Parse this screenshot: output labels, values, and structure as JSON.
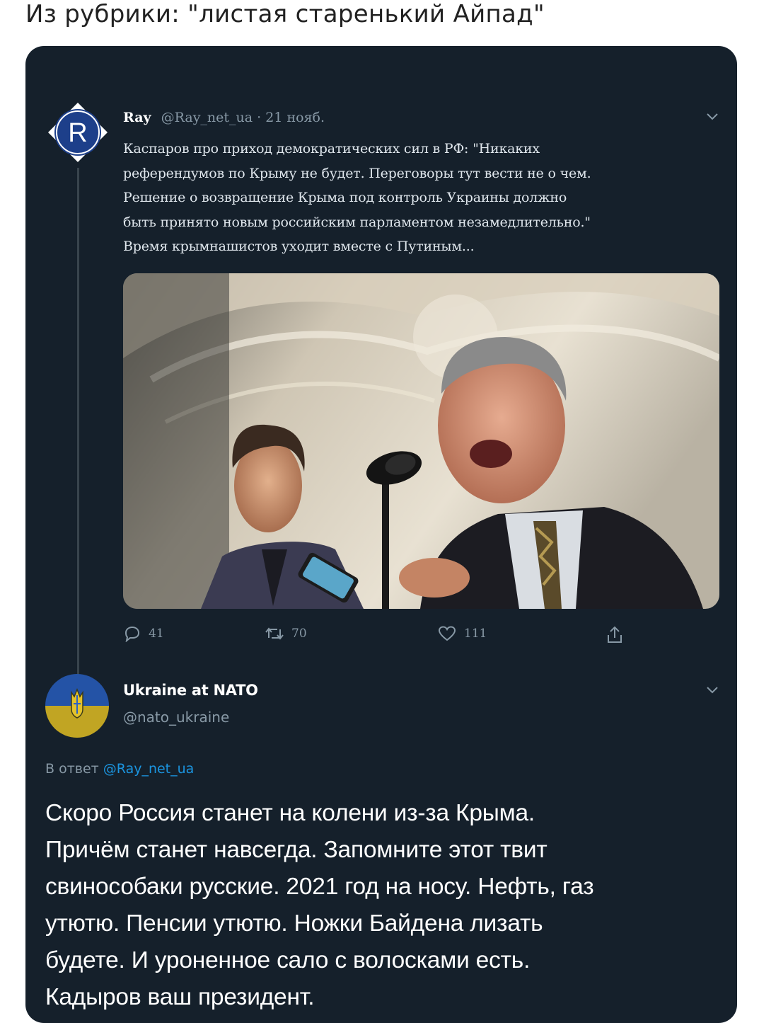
{
  "post": {
    "title": "Из рубрики: \"листая старенький Айпад\""
  },
  "tweet": {
    "author_name": "Ray",
    "author_handle": "@Ray_net_ua",
    "separator": "·",
    "date": "21 нояб.",
    "avatar_letter": "R",
    "text_lines": [
      "Каспаров про приход демократических сил в РФ: \"Никаких",
      "референдумов по Крыму не будет. Переговоры тут вести не о чем.",
      "Решение о возвращение Крыма под контроль Украины должно",
      "быть принято новым российским парламентом незамедлительно.\"",
      "Время крымнашистов уходит вместе с Путиным..."
    ],
    "actions": {
      "replies": "41",
      "retweets": "70",
      "likes": "111"
    }
  },
  "reply": {
    "author_name": "Ukraine at NATO",
    "author_handle": "@nato_ukraine",
    "reply_prefix": "В ответ",
    "reply_mention": "@Ray_net_ua",
    "text_lines": [
      "Скоро Россия станет на колени из-за Крыма.",
      "Причём станет навсегда. Запомните этот твит",
      "свинособаки русские. 2021 год на носу. Нефть, газ",
      "утютю. Пенсии утютю. Ножки Байдена лизать",
      "будете. И уроненное сало с волосками есть.",
      "Кадыров ваш президент."
    ]
  },
  "colors": {
    "background": "#15202b",
    "secondary_text": "#8899a6",
    "link": "#1b95e0",
    "avatar_blue": "#1d3f8a"
  },
  "icons": [
    "reply-icon",
    "retweet-icon",
    "like-icon",
    "share-icon",
    "chevron-down-icon"
  ]
}
